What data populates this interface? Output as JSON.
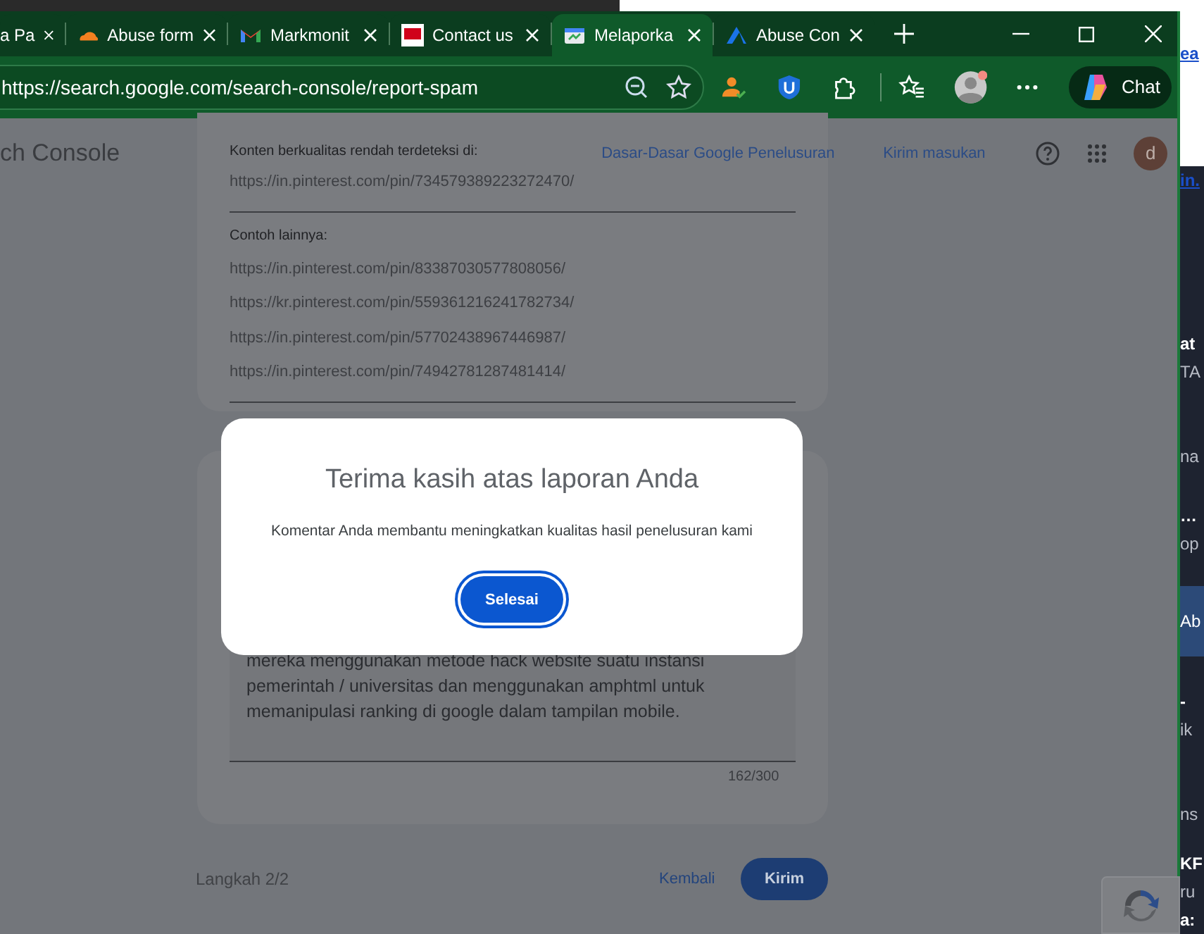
{
  "browser": {
    "tabs": [
      {
        "label": "a Pa",
        "kind": "plain",
        "selected": false
      },
      {
        "label": "Abuse form",
        "kind": "cloud",
        "selected": false
      },
      {
        "label": "Markmonit",
        "kind": "mail",
        "selected": false
      },
      {
        "label": "Contact us",
        "kind": "square",
        "selected": false
      },
      {
        "label": "Melaporka",
        "kind": "console",
        "selected": true
      },
      {
        "label": "Abuse Con",
        "kind": "triangle",
        "selected": false
      }
    ],
    "address": "https://search.google.com/search-console/report-spam",
    "chat_button": "Chat"
  },
  "header": {
    "app_name": "ch Console",
    "links": [
      "Dasar-Dasar Google Penelusuran",
      "Kirim masukan"
    ],
    "avatar": "d"
  },
  "report_card": {
    "detected_label": "Konten berkualitas rendah terdeteksi di:",
    "detected_url": "https://in.pinterest.com/pin/734579389223272470/",
    "others_label": "Contoh lainnya:",
    "other_urls": [
      "https://in.pinterest.com/pin/83387030577808056/",
      "https://kr.pinterest.com/pin/559361216241782734/",
      "https://in.pinterest.com/pin/57702438967446987/",
      "https://in.pinterest.com/pin/74942781287481414/"
    ]
  },
  "comment": {
    "lines": [
      "mereka menggunakan metode hack website suatu instansi",
      "pemerintah / universitas dan menggunakan amphtml untuk",
      "memanipulasi ranking di google dalam tampilan mobile."
    ],
    "counter": "162/300"
  },
  "footer": {
    "step": "Langkah 2/2",
    "back": "Kembali",
    "submit": "Kirim"
  },
  "dialog": {
    "title": "Terima kasih atas laporan Anda",
    "message": "Komentar Anda membantu meningkatkan kualitas hasil penelusuran kami",
    "button": "Selesai"
  },
  "background_window": {
    "items": [
      {
        "text": "ea",
        "kind": "link"
      },
      {
        "text": "in.",
        "kind": "link"
      },
      {
        "text": "at",
        "kind": "bold"
      },
      {
        "text": "TA",
        "kind": "plain"
      },
      {
        "text": "na",
        "kind": "plain"
      },
      {
        "text": "…",
        "kind": "bold"
      },
      {
        "text": "op",
        "kind": "plain"
      },
      {
        "text": "Ab",
        "kind": "band"
      },
      {
        "text": "-",
        "kind": "bold"
      },
      {
        "text": "ik",
        "kind": "plain"
      },
      {
        "text": "ns",
        "kind": "plain"
      },
      {
        "text": "KF",
        "kind": "bold"
      },
      {
        "text": "ru",
        "kind": "plain"
      },
      {
        "text": "a:",
        "kind": "bold"
      }
    ]
  }
}
